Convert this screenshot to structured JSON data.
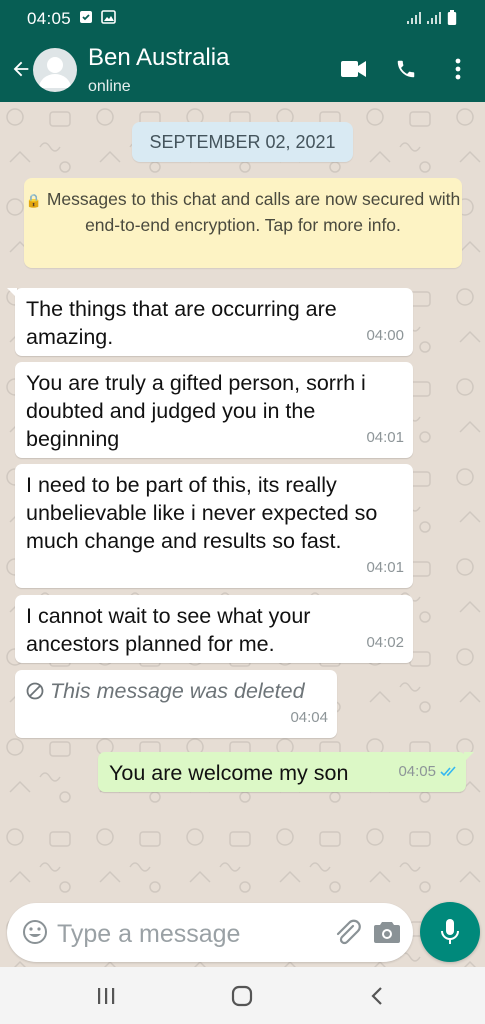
{
  "status_bar": {
    "time": "04:05"
  },
  "header": {
    "contact_name": "Ben Australia",
    "contact_status": "online"
  },
  "chat": {
    "date_label": "SEPTEMBER 02, 2021",
    "encryption_notice": "Messages to this chat and calls are now secured with end-to-end encryption. Tap for more info."
  },
  "messages": [
    {
      "direction": "incoming",
      "text": "The things that are occurring are amazing.",
      "time": "04:00"
    },
    {
      "direction": "incoming",
      "text": "You are truly a gifted person, sorrh i doubted and judged you in the beginning",
      "time": "04:01"
    },
    {
      "direction": "incoming",
      "text": "I need to be part of this, its really unbelievable like i never expected so much change and results so fast.",
      "time": "04:01"
    },
    {
      "direction": "incoming",
      "text": "I cannot wait to see what your ancestors planned for me.",
      "time": "04:02"
    },
    {
      "direction": "incoming",
      "text": "This message was deleted",
      "time": "04:04",
      "deleted": true
    },
    {
      "direction": "outgoing",
      "text": "You are welcome my son",
      "time": "04:05",
      "read_status": "read"
    }
  ],
  "composer": {
    "placeholder": "Type a message"
  },
  "icons": {
    "back": "arrow-left-icon",
    "video": "video-call-icon",
    "voice": "phone-icon",
    "menu": "more-vert-icon",
    "emoji": "emoji-icon",
    "attach": "paperclip-icon",
    "camera": "camera-icon",
    "mic": "microphone-icon"
  },
  "colors": {
    "header": "#075e54",
    "outgoing_bubble": "#dcf8c6",
    "notice": "#fdf3c4",
    "date_pill": "#d9eaf3",
    "fab": "#00897b",
    "read_ticks": "#34b7f1"
  }
}
